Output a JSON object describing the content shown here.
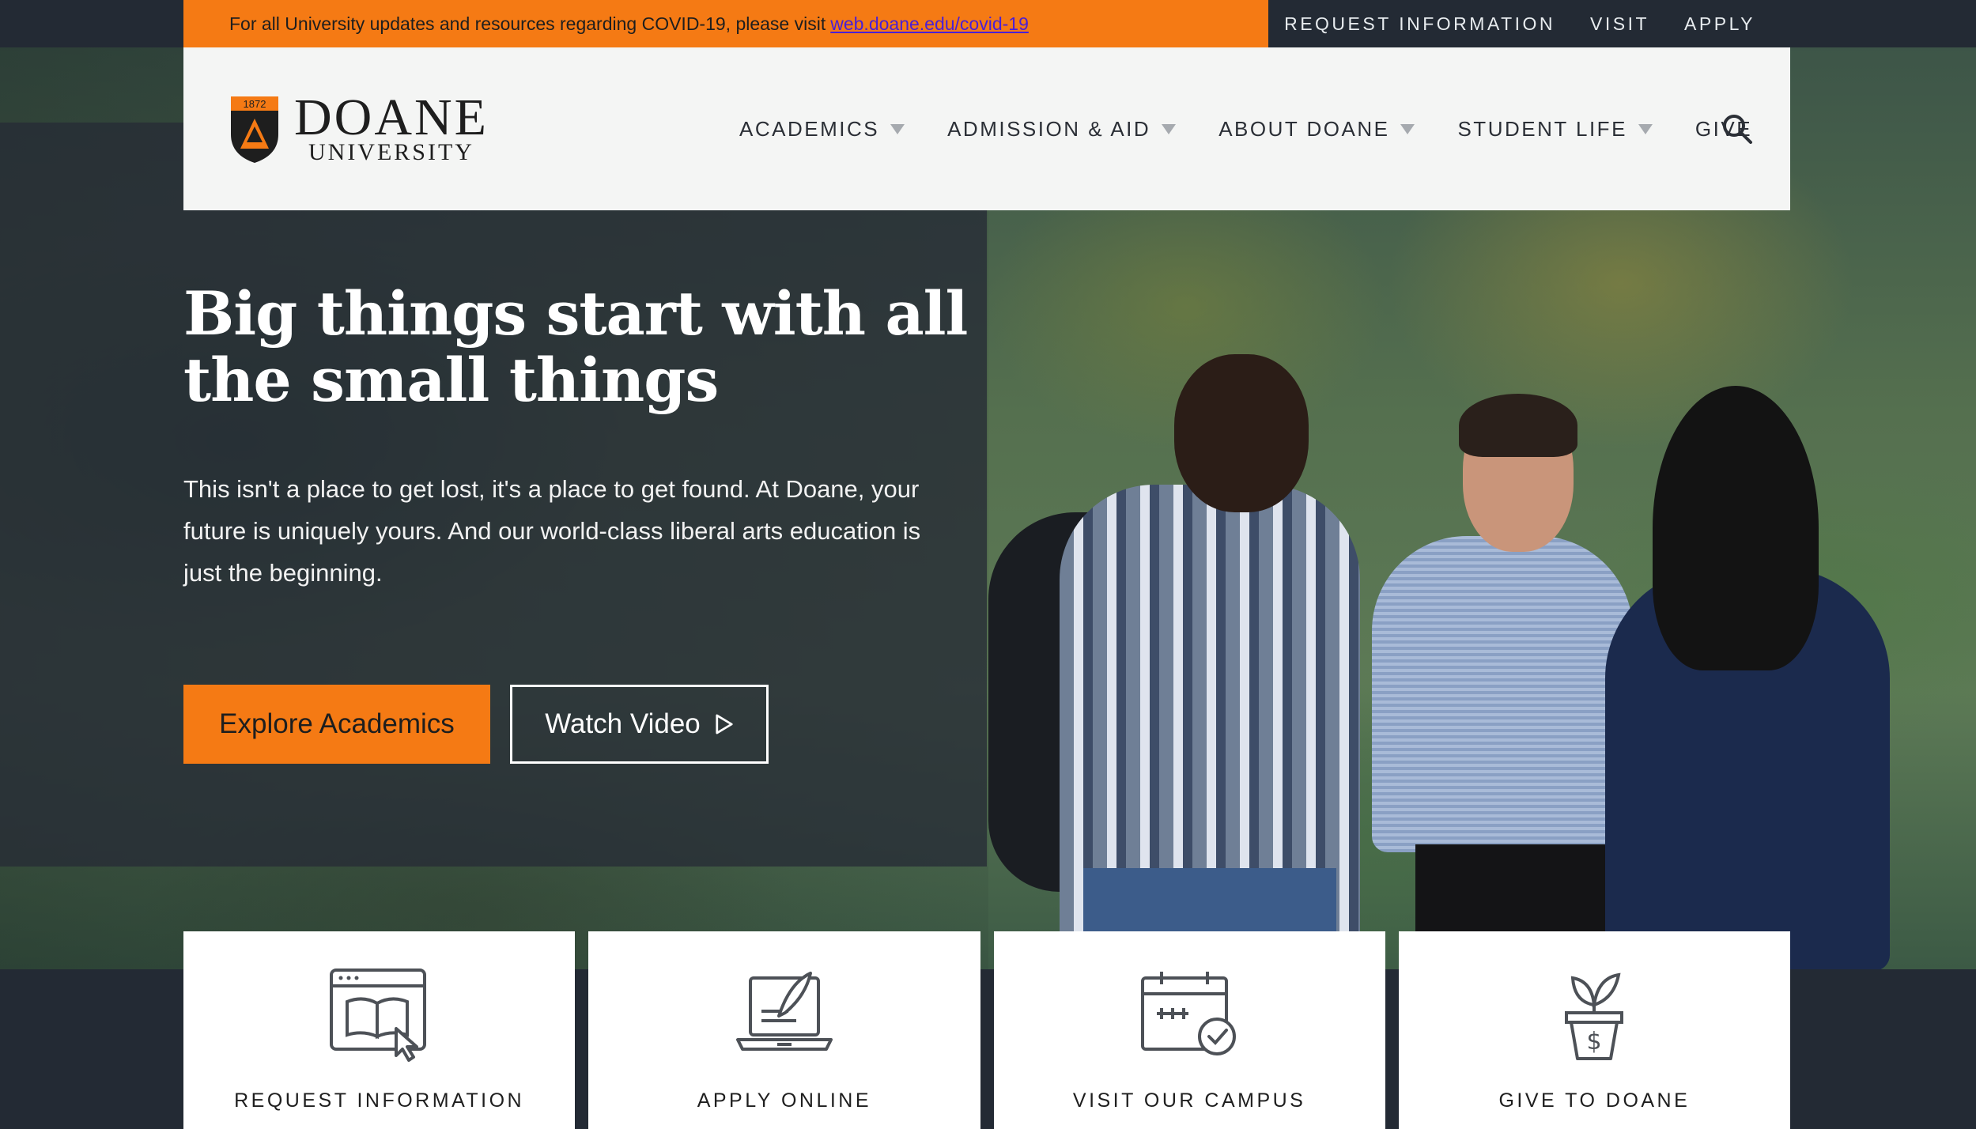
{
  "covid_banner": {
    "text": "For all University updates and resources regarding COVID-19, please visit",
    "link_text": "web.doane.edu/covid-19"
  },
  "utility_nav": [
    "REQUEST INFORMATION",
    "VISIT",
    "APPLY"
  ],
  "logo": {
    "year": "1872",
    "name": "DOANE",
    "subtitle": "UNIVERSITY"
  },
  "main_nav": [
    {
      "label": "ACADEMICS",
      "dropdown": true
    },
    {
      "label": "ADMISSION & AID",
      "dropdown": true
    },
    {
      "label": "ABOUT DOANE",
      "dropdown": true
    },
    {
      "label": "STUDENT LIFE",
      "dropdown": true
    },
    {
      "label": "GIVE",
      "dropdown": false
    }
  ],
  "hero": {
    "title_line1": "Big things start with all",
    "title_line2": "the small things",
    "body": "This isn't a place to get lost, it's a place to get found. At Doane, your future is uniquely yours. And our world-class liberal arts education is just the beginning.",
    "primary_button": "Explore Academics",
    "secondary_button": "Watch Video"
  },
  "cards": [
    {
      "label": "REQUEST INFORMATION",
      "icon": "browser-book-icon"
    },
    {
      "label": "APPLY ONLINE",
      "icon": "laptop-quill-icon"
    },
    {
      "label": "VISIT OUR CAMPUS",
      "icon": "calendar-check-icon"
    },
    {
      "label": "GIVE TO DOANE",
      "icon": "plant-pot-dollar-icon"
    }
  ],
  "colors": {
    "accent": "#f57a14",
    "dark": "#232a34",
    "link": "#4a1fd6",
    "header_bg": "#f4f5f4"
  }
}
